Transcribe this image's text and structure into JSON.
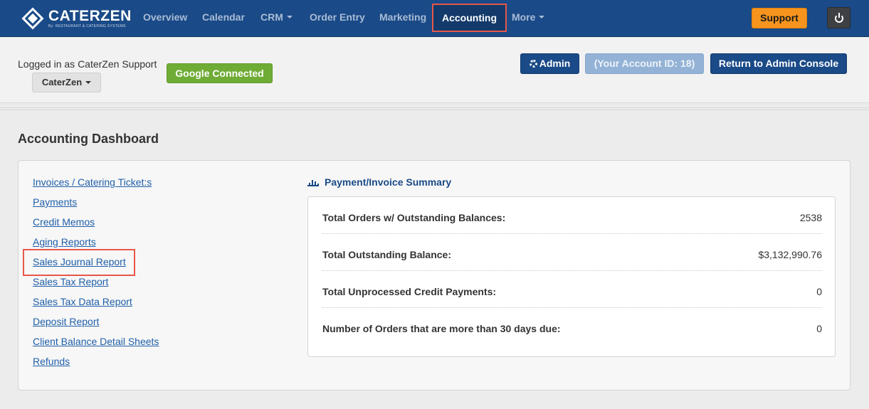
{
  "brand": {
    "name": "CATERZEN",
    "tagline": "By: RESTAURANT & CATERING SYSTEMS"
  },
  "nav": {
    "items": [
      "Overview",
      "Calendar",
      "CRM",
      "Order Entry",
      "Marketing",
      "Accounting",
      "More"
    ],
    "active": "Accounting",
    "support": "Support"
  },
  "account": {
    "logged_in": "Logged in as CaterZen Support",
    "company": "CaterZen",
    "google": "Google Connected",
    "admin": "Admin",
    "account_id": "(Your Account ID: 18)",
    "return": "Return to Admin Console"
  },
  "dashboard": {
    "title": "Accounting Dashboard",
    "links": [
      "Invoices / Catering Ticket:s",
      "Payments",
      "Credit Memos",
      "Aging Reports",
      "Sales Journal Report",
      "Sales Tax Report",
      "Sales Tax Data Report",
      "Deposit Report",
      "Client Balance Detail Sheets",
      "Refunds"
    ],
    "summary": {
      "title": "Payment/Invoice Summary",
      "rows": [
        {
          "label": "Total Orders w/ Outstanding Balances:",
          "value": "2538"
        },
        {
          "label": "Total Outstanding Balance:",
          "value": "$3,132,990.76"
        },
        {
          "label": "Total Unprocessed Credit Payments:",
          "value": "0"
        },
        {
          "label": "Number of Orders that are more than 30 days due:",
          "value": "0"
        }
      ]
    }
  },
  "colors": {
    "nav_bg": "#1a4a87",
    "support": "#f7941d",
    "google": "#6fac35",
    "highlight": "#e8574b",
    "link": "#1f5fa8"
  }
}
